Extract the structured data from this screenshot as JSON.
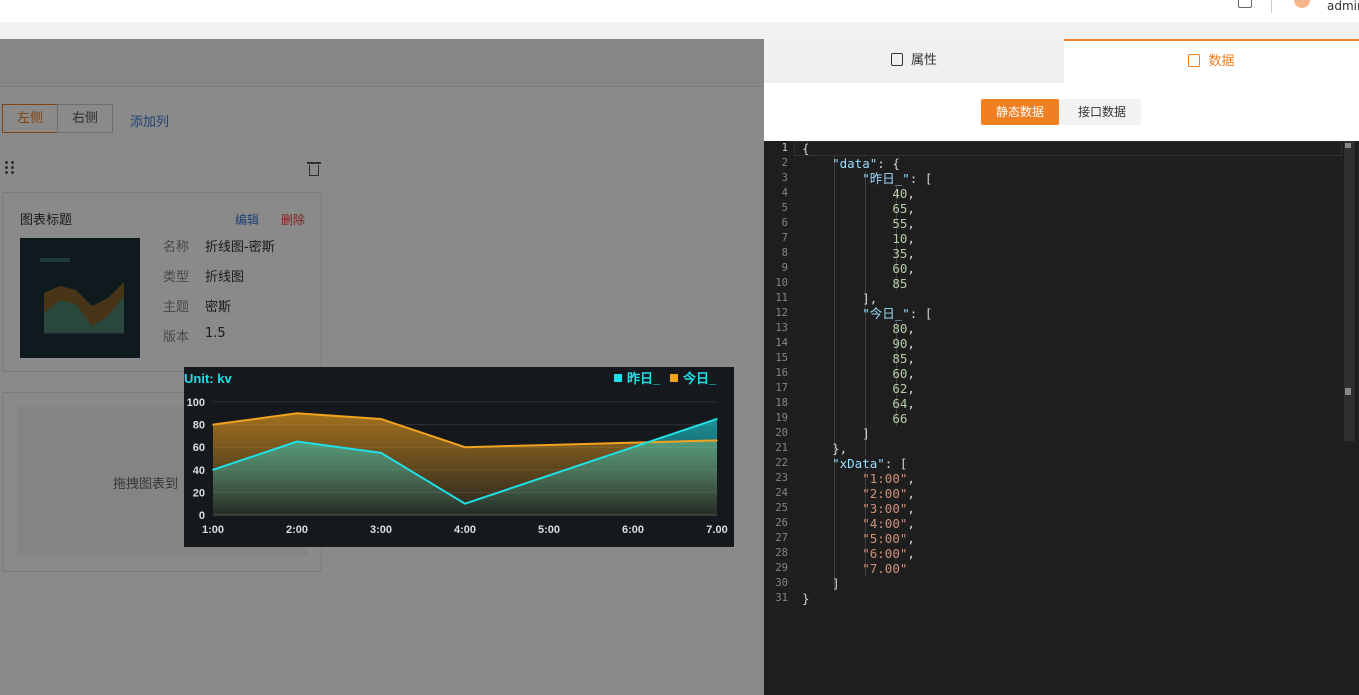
{
  "header": {
    "username": "admin"
  },
  "editor_left": {
    "segments": [
      "左侧",
      "右侧"
    ],
    "add_column": "添加列",
    "card": {
      "title": "图表标题",
      "edit": "编辑",
      "delete": "删除",
      "meta": [
        {
          "key": "名称",
          "value": "折线图-密斯"
        },
        {
          "key": "类型",
          "value": "折线图"
        },
        {
          "key": "主题",
          "value": "密斯"
        },
        {
          "key": "版本",
          "value": "1.5"
        }
      ]
    },
    "dropzone_text": "拖拽图表到"
  },
  "chart_preview": {
    "unit_label": "Unit: kv",
    "colors": {
      "series1": "#1fe0e6",
      "series2": "#f2a31e",
      "background": "#15191e"
    }
  },
  "chart_data": {
    "type": "area",
    "categories": [
      "1:00",
      "2:00",
      "3:00",
      "4:00",
      "5:00",
      "6:00",
      "7.00"
    ],
    "series": [
      {
        "name": "昨日_",
        "values": [
          40,
          65,
          55,
          10,
          35,
          60,
          85
        ]
      },
      {
        "name": "今日_",
        "values": [
          80,
          90,
          85,
          60,
          62,
          64,
          66
        ]
      }
    ],
    "yticks": [
      0,
      20,
      40,
      60,
      80,
      100
    ],
    "ylim": [
      0,
      100
    ],
    "legend": "top-right",
    "grid": true
  },
  "right_panel": {
    "tabs": [
      {
        "label": "属性",
        "icon": "settings-doc-icon"
      },
      {
        "label": "数据",
        "icon": "data-nodes-icon"
      }
    ],
    "active_tab": "数据",
    "source_buttons": [
      "静态数据",
      "接口数据"
    ],
    "active_source": "静态数据"
  },
  "code_lines": [
    [
      [
        "p",
        "{"
      ]
    ],
    [
      [
        "p",
        "    "
      ],
      [
        "k",
        "\"data\""
      ],
      [
        "p",
        ": {"
      ]
    ],
    [
      [
        "p",
        "        "
      ],
      [
        "k",
        "\"昨日_\""
      ],
      [
        "p",
        ": ["
      ]
    ],
    [
      [
        "p",
        "            "
      ],
      [
        "n",
        "40"
      ],
      [
        "p",
        ","
      ]
    ],
    [
      [
        "p",
        "            "
      ],
      [
        "n",
        "65"
      ],
      [
        "p",
        ","
      ]
    ],
    [
      [
        "p",
        "            "
      ],
      [
        "n",
        "55"
      ],
      [
        "p",
        ","
      ]
    ],
    [
      [
        "p",
        "            "
      ],
      [
        "n",
        "10"
      ],
      [
        "p",
        ","
      ]
    ],
    [
      [
        "p",
        "            "
      ],
      [
        "n",
        "35"
      ],
      [
        "p",
        ","
      ]
    ],
    [
      [
        "p",
        "            "
      ],
      [
        "n",
        "60"
      ],
      [
        "p",
        ","
      ]
    ],
    [
      [
        "p",
        "            "
      ],
      [
        "n",
        "85"
      ]
    ],
    [
      [
        "p",
        "        ],"
      ]
    ],
    [
      [
        "p",
        "        "
      ],
      [
        "k",
        "\"今日_\""
      ],
      [
        "p",
        ": ["
      ]
    ],
    [
      [
        "p",
        "            "
      ],
      [
        "n",
        "80"
      ],
      [
        "p",
        ","
      ]
    ],
    [
      [
        "p",
        "            "
      ],
      [
        "n",
        "90"
      ],
      [
        "p",
        ","
      ]
    ],
    [
      [
        "p",
        "            "
      ],
      [
        "n",
        "85"
      ],
      [
        "p",
        ","
      ]
    ],
    [
      [
        "p",
        "            "
      ],
      [
        "n",
        "60"
      ],
      [
        "p",
        ","
      ]
    ],
    [
      [
        "p",
        "            "
      ],
      [
        "n",
        "62"
      ],
      [
        "p",
        ","
      ]
    ],
    [
      [
        "p",
        "            "
      ],
      [
        "n",
        "64"
      ],
      [
        "p",
        ","
      ]
    ],
    [
      [
        "p",
        "            "
      ],
      [
        "n",
        "66"
      ]
    ],
    [
      [
        "p",
        "        ]"
      ]
    ],
    [
      [
        "p",
        "    },"
      ]
    ],
    [
      [
        "p",
        "    "
      ],
      [
        "k",
        "\"xData\""
      ],
      [
        "p",
        ": ["
      ]
    ],
    [
      [
        "p",
        "        "
      ],
      [
        "s",
        "\"1:00\""
      ],
      [
        "p",
        ","
      ]
    ],
    [
      [
        "p",
        "        "
      ],
      [
        "s",
        "\"2:00\""
      ],
      [
        "p",
        ","
      ]
    ],
    [
      [
        "p",
        "        "
      ],
      [
        "s",
        "\"3:00\""
      ],
      [
        "p",
        ","
      ]
    ],
    [
      [
        "p",
        "        "
      ],
      [
        "s",
        "\"4:00\""
      ],
      [
        "p",
        ","
      ]
    ],
    [
      [
        "p",
        "        "
      ],
      [
        "s",
        "\"5:00\""
      ],
      [
        "p",
        ","
      ]
    ],
    [
      [
        "p",
        "        "
      ],
      [
        "s",
        "\"6:00\""
      ],
      [
        "p",
        ","
      ]
    ],
    [
      [
        "p",
        "        "
      ],
      [
        "s",
        "\"7.00\""
      ]
    ],
    [
      [
        "p",
        "    ]"
      ]
    ],
    [
      [
        "p",
        "}"
      ]
    ]
  ]
}
